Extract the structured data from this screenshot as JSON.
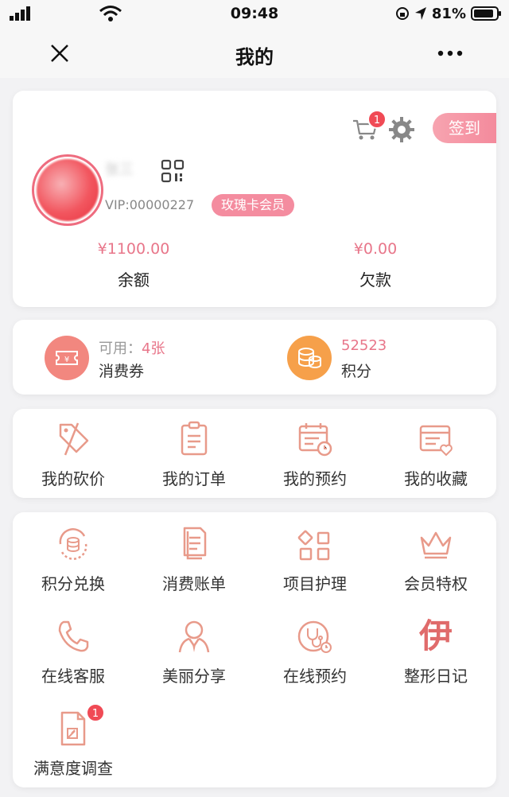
{
  "status_bar": {
    "time": "09:48",
    "battery": "81%"
  },
  "nav": {
    "title": "我的"
  },
  "profile": {
    "cart_badge": "1",
    "checkin_label": "签到",
    "username": "张三",
    "vip_number": "VIP:00000227",
    "member_tag": "玫瑰卡会员",
    "balance": {
      "amount": "¥1100.00",
      "label": "余额"
    },
    "debt": {
      "amount": "¥0.00",
      "label": "欠款"
    }
  },
  "summary": {
    "voucher": {
      "available_label": "可用：",
      "available_count": "4张",
      "label": "消费券"
    },
    "points": {
      "value": "52523",
      "label": "积分"
    }
  },
  "orders_row": [
    {
      "label": "我的砍价",
      "icon": "price-tag-icon"
    },
    {
      "label": "我的订单",
      "icon": "clipboard-icon"
    },
    {
      "label": "我的预约",
      "icon": "calendar-clock-icon"
    },
    {
      "label": "我的收藏",
      "icon": "favorites-card-icon"
    }
  ],
  "services": [
    {
      "label": "积分兑换",
      "icon": "points-exchange-icon"
    },
    {
      "label": "消费账单",
      "icon": "bill-icon"
    },
    {
      "label": "项目护理",
      "icon": "grid-items-icon"
    },
    {
      "label": "会员特权",
      "icon": "crown-icon"
    },
    {
      "label": "在线客服",
      "icon": "phone-icon"
    },
    {
      "label": "美丽分享",
      "icon": "person-share-icon"
    },
    {
      "label": "在线预约",
      "icon": "stethoscope-clock-icon"
    },
    {
      "label": "整形日记",
      "icon": "yi-character-icon",
      "glyph": "伊"
    },
    {
      "label": "满意度调查",
      "icon": "survey-document-icon",
      "badge": "1"
    }
  ],
  "colors": {
    "accent_pink": "#e8768a",
    "icon_salmon": "#e89a8a",
    "badge_red": "#f04a55",
    "voucher_circle": "#f2877f",
    "points_circle": "#f6a04a"
  }
}
